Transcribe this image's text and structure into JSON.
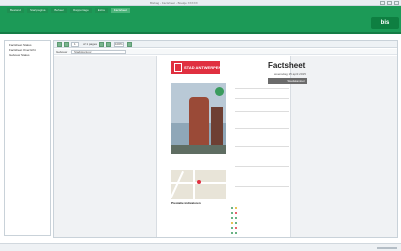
{
  "window": {
    "title": "Bisbag - Factsheet - Boekje XXXXX"
  },
  "ribbon": {
    "tabs": [
      "Bestand",
      "Startpagina",
      "Beheer",
      "Rapportage",
      "Extra",
      "Factsheet"
    ],
    "active_tab_index": 5,
    "logo": "bis"
  },
  "sidebar": {
    "items": [
      "Factsheet Status",
      "Factsheet Overzicht",
      "Gebouw Status"
    ]
  },
  "toolbar": {
    "page": "1",
    "of_pages": "of 1 pages",
    "zoom": "100%"
  },
  "subbar": {
    "label": "Gebouw",
    "value": "Stadskantoor"
  },
  "document": {
    "city_header": "STAD ANTWERPEN",
    "title": "Factsheet",
    "date": "woensdag 15 april 2015",
    "building_name": "Stadskantoor",
    "section_label": "Prestatie indicatoren"
  },
  "colors": {
    "ribbon": "#1c9a57",
    "accent": "#e03040"
  }
}
